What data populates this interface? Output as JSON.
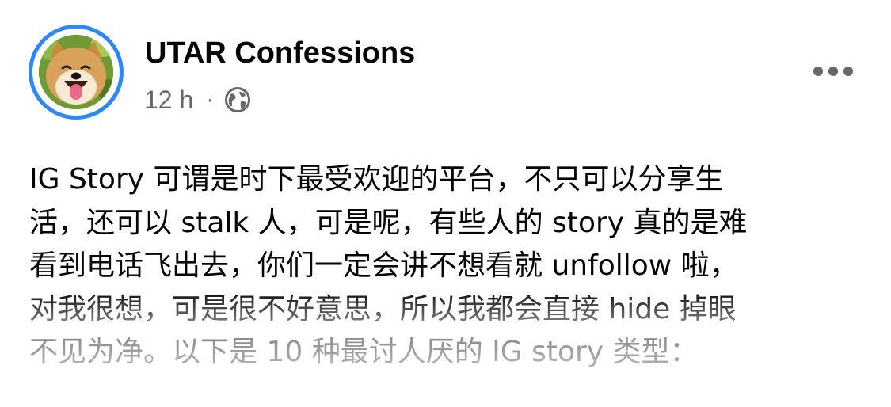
{
  "post": {
    "author": {
      "name": "UTAR Confessions",
      "avatar_icon": "shiba-dog-avatar",
      "story_ring_color": "#2d88ff"
    },
    "timestamp": "12 h",
    "separator": "·",
    "audience_icon": "globe-icon",
    "more_icon": "more-options-icon",
    "text": "IG Story 可谓是时下最受欢迎的平台，不只可以分享生\n活，还可以 stalk 人，可是呢，有些人的 story 真的是难\n看到电话飞出去，你们一定会讲不想看就 unfollow 啦，\n对我很想，可是很不好意思，所以我都会直接 hide 掉眼\n不见为净。以下是 10 种最讨人厌的 IG story 类型："
  },
  "colors": {
    "text_primary": "#050505",
    "text_secondary": "#65676b",
    "accent": "#2d88ff"
  }
}
